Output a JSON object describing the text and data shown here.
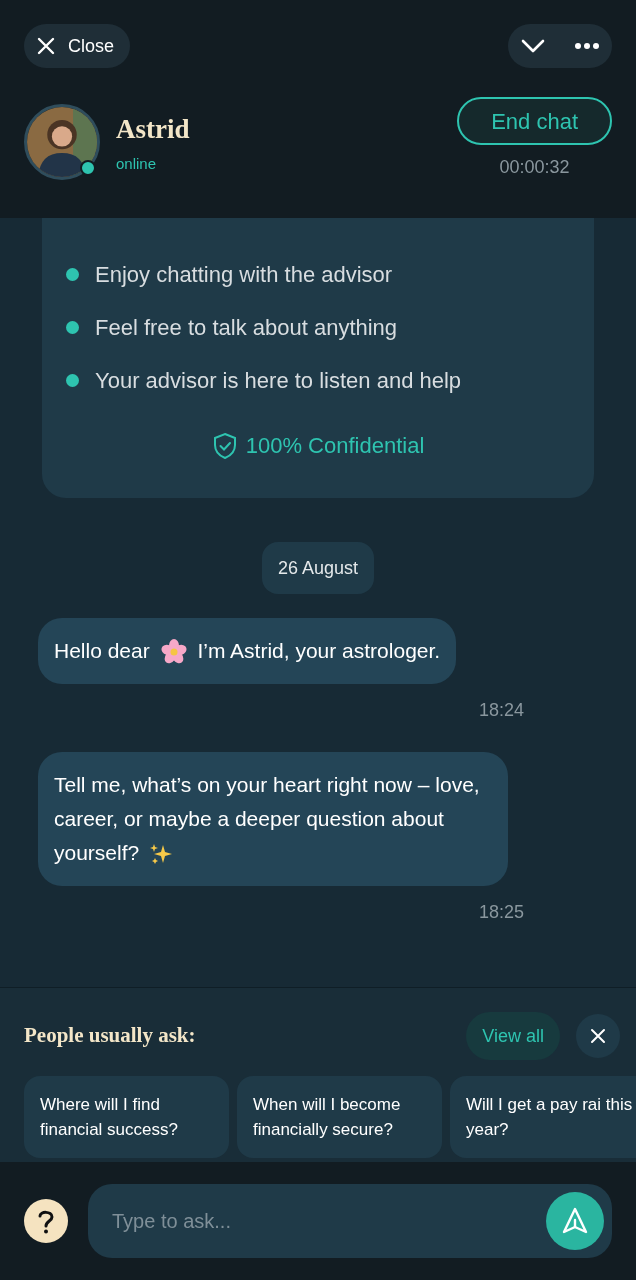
{
  "top_bar": {
    "close_label": "Close"
  },
  "advisor": {
    "name": "Astrid",
    "status": "online",
    "online": true,
    "end_label": "End chat",
    "timer": "00:00:32"
  },
  "intro_card": {
    "bullets": [
      "Enjoy chatting with the advisor",
      "Feel free to talk about anything",
      "Your advisor is here to listen and help"
    ],
    "badge": "100% Confidential"
  },
  "date_label": "26 August",
  "messages": [
    {
      "parts": [
        {
          "kind": "text",
          "text": "Hello dear"
        },
        {
          "kind": "flower"
        },
        {
          "kind": "text",
          "text": "I’m Astrid, your astrologer."
        }
      ],
      "time": "18:24"
    },
    {
      "parts": [
        {
          "kind": "text",
          "text": "Tell me, what’s on your heart right now – love, career, or maybe a deeper question about yourself?"
        },
        {
          "kind": "sparkles"
        }
      ],
      "time": "18:25"
    }
  ],
  "suggestions": {
    "title": "People usually ask:",
    "view_all": "View all",
    "items": [
      "Where will I find financial success?",
      "When will I become financially secure?",
      "Will I get a pay rai this year?"
    ]
  },
  "composer": {
    "placeholder": "Type to ask..."
  }
}
